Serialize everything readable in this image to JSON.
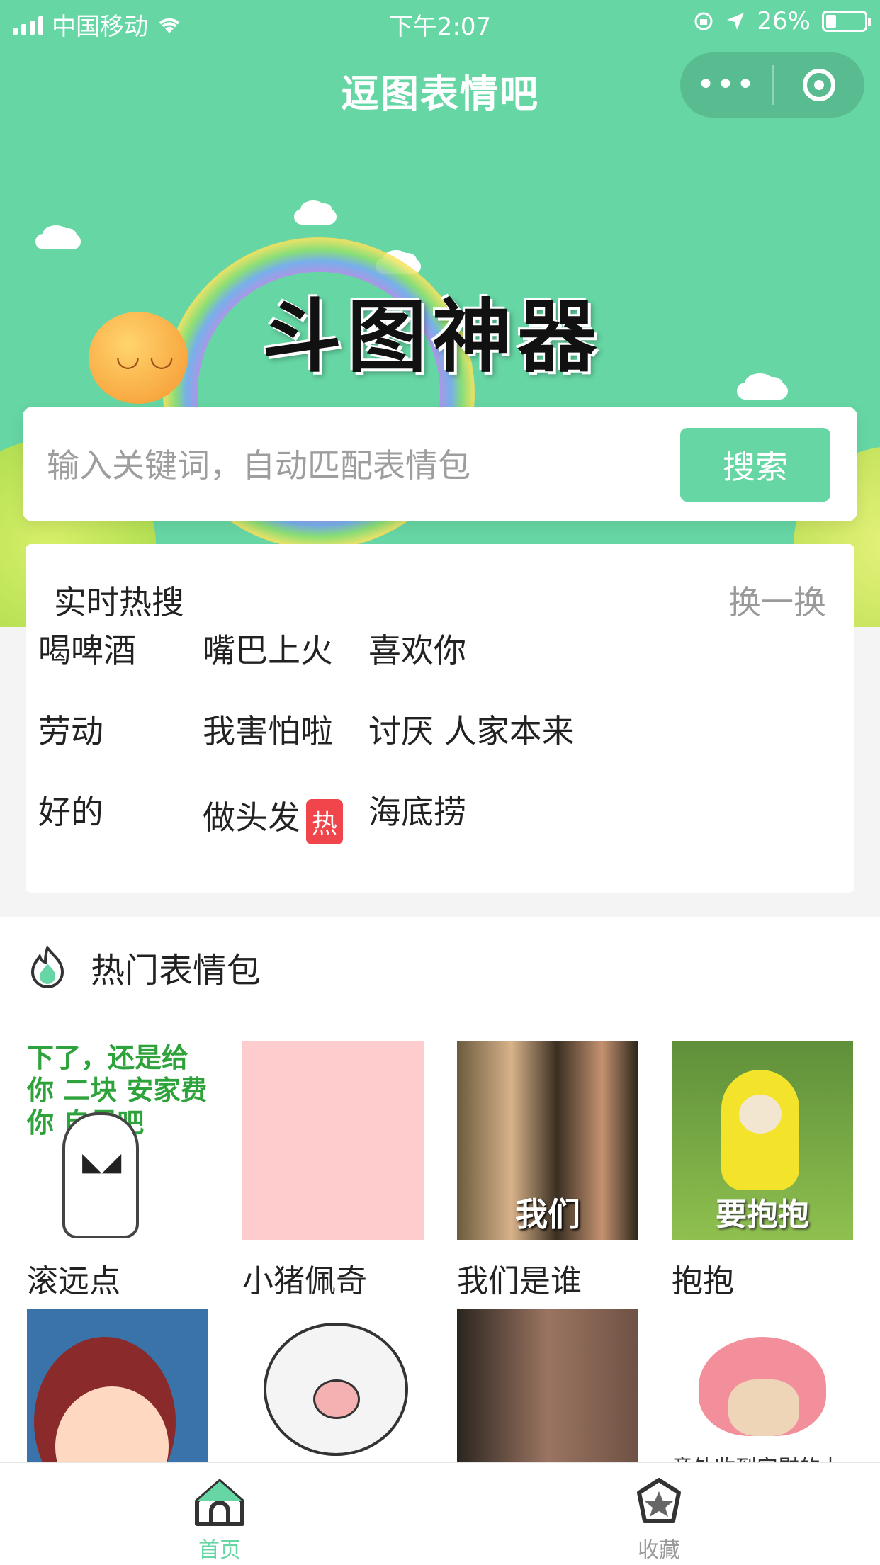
{
  "status_bar": {
    "carrier": "中国移动",
    "time": "下午2:07",
    "battery_percent": "26%",
    "battery_level": 0.26
  },
  "nav": {
    "title": "逗图表情吧",
    "more_glyph": "•••"
  },
  "banner": {
    "title": "斗图神器"
  },
  "search": {
    "placeholder": "输入关键词，自动匹配表情包",
    "button_label": "搜索"
  },
  "hot_search": {
    "title": "实时热搜",
    "refresh_label": "换一换",
    "hot_badge": "热",
    "items": [
      {
        "label": "喝啤酒"
      },
      {
        "label": "嘴巴上火"
      },
      {
        "label": "喜欢你"
      },
      {
        "label": "劳动"
      },
      {
        "label": "我害怕啦"
      },
      {
        "label": "讨厌 人家本来"
      },
      {
        "label": "好的"
      },
      {
        "label": "做头发",
        "hot": true
      },
      {
        "label": "海底捞"
      }
    ]
  },
  "popular": {
    "title": "热门表情包",
    "items": [
      {
        "caption": "滚远点",
        "overlay": "下了，还是给你 二块 安家费 你 自尽吧"
      },
      {
        "caption": "小猪佩奇",
        "overlay": ""
      },
      {
        "caption": "我们是谁",
        "overlay": "我们"
      },
      {
        "caption": "抱抱",
        "overlay": "要抱抱"
      },
      {
        "caption": "",
        "overlay": ""
      },
      {
        "caption": "",
        "overlay": ""
      },
      {
        "caption": "",
        "overlay": ""
      },
      {
        "caption": "",
        "overlay": "意外收到安慰的上"
      }
    ]
  },
  "tabbar": {
    "tabs": [
      {
        "label": "首页",
        "icon": "home-icon",
        "active": true
      },
      {
        "label": "收藏",
        "icon": "star-icon",
        "active": false
      }
    ]
  },
  "colors": {
    "accent": "#66d6a4",
    "hot_badge": "#f0454a",
    "tab_inactive": "#9a9a9a"
  }
}
